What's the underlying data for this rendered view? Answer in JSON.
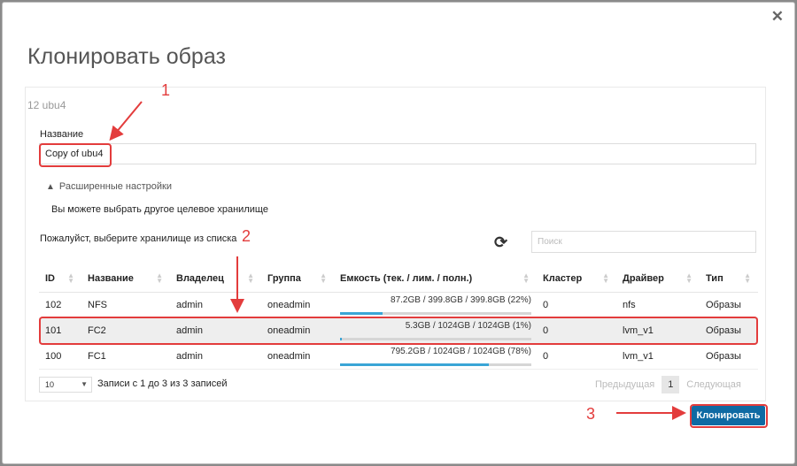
{
  "dialog": {
    "title": "Клонировать образ",
    "subtitle": "12 ubu4",
    "close_icon": "close-icon"
  },
  "form": {
    "name_label": "Название",
    "name_value": "Copy of ubu4",
    "advanced_label": "Расширенные настройки",
    "alt_storage_text": "Вы можете выбрать другое целевое хранилище",
    "choose_storage_text": "Пожалуйст, выберите хранилище из списка",
    "search_placeholder": "Поиск"
  },
  "table": {
    "headers": [
      "ID",
      "Название",
      "Владелец",
      "Группа",
      "Емкость (тек. / лим. / полн.)",
      "Кластер",
      "Драйвер",
      "Тип"
    ],
    "rows": [
      {
        "id": "102",
        "name": "NFS",
        "owner": "admin",
        "group": "oneadmin",
        "capacity": "87.2GB / 399.8GB / 399.8GB (22%)",
        "usage": 0.22,
        "cluster": "0",
        "driver": "nfs",
        "type": "Образы"
      },
      {
        "id": "101",
        "name": "FC2",
        "owner": "admin",
        "group": "oneadmin",
        "capacity": "5.3GB / 1024GB / 1024GB (1%)",
        "usage": 0.01,
        "cluster": "0",
        "driver": "lvm_v1",
        "type": "Образы"
      },
      {
        "id": "100",
        "name": "FC1",
        "owner": "admin",
        "group": "oneadmin",
        "capacity": "795.2GB / 1024GB / 1024GB (78%)",
        "usage": 0.78,
        "cluster": "0",
        "driver": "lvm_v1",
        "type": "Образы"
      }
    ]
  },
  "footer": {
    "page_length": "10",
    "info": "Записи с 1 до 3 из 3 записей",
    "prev": "Предыдущая",
    "page": "1",
    "next": "Следующая"
  },
  "actions": {
    "clone": "Клонировать"
  },
  "annotations": {
    "n1": "1",
    "n2": "2",
    "n3": "3",
    "color": "#e33c3c"
  },
  "colors": {
    "accent": "#0f6aa3",
    "bar_fill": "#3aa5d6"
  }
}
